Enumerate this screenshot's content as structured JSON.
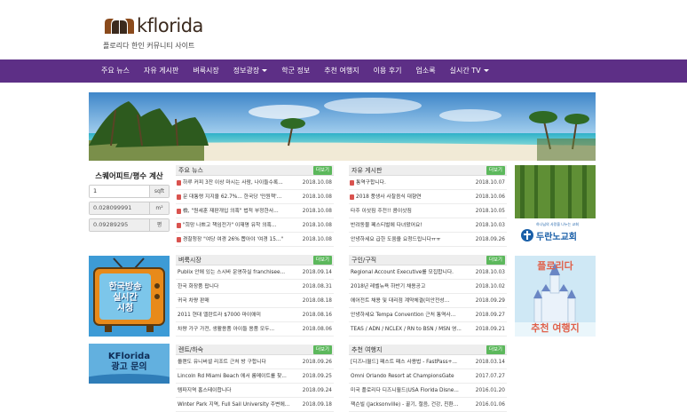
{
  "header": {
    "logo_text": "kflorida",
    "tagline": "플로리다 한인 커뮤니티 사이트"
  },
  "nav": {
    "items": [
      {
        "label": "주요 뉴스",
        "dropdown": false
      },
      {
        "label": "자유 게시판",
        "dropdown": false
      },
      {
        "label": "벼룩시장",
        "dropdown": false
      },
      {
        "label": "정보광장",
        "dropdown": true
      },
      {
        "label": "학군 정보",
        "dropdown": false
      },
      {
        "label": "추천 여행지",
        "dropdown": false
      },
      {
        "label": "이용 후기",
        "dropdown": false
      },
      {
        "label": "업소록",
        "dropdown": false
      },
      {
        "label": "실시간 TV",
        "dropdown": true
      }
    ]
  },
  "calculator": {
    "title": "스퀘어피트/평수 계산",
    "rows": [
      {
        "value": "1",
        "unit": "sqft",
        "readonly": false
      },
      {
        "value": "0.028099991",
        "unit": "m²",
        "readonly": true
      },
      {
        "value": "0.09289295",
        "unit": "평",
        "readonly": true
      }
    ]
  },
  "ads": {
    "tv": {
      "line1": "한국방송",
      "line2": "실시간",
      "line3": "시청"
    },
    "kflorida": {
      "line1": "KFlorida",
      "line2": "광고 문의"
    },
    "church": {
      "small": "하나님의 사랑을 나누는 교회",
      "name": "두란노교회"
    },
    "tour": {
      "line1": "플로리다",
      "line2": "추천 여행지"
    }
  },
  "boards": {
    "news": {
      "title": "주요 뉴스",
      "more": "더보기",
      "rows": [
        {
          "title": "하루 커피 3잔 이상 마시는 사람, 나이들수록...",
          "date": "2018.10.08",
          "new": true
        },
        {
          "title": "문 대통령 지지율 62.7%... 한국당 '민원책'...",
          "date": "2018.10.08",
          "new": true
        },
        {
          "title": "檢, \"원세훈 재판개입 의혹\" 법적 부정한사...",
          "date": "2018.10.08",
          "new": true
        },
        {
          "title": "\"희망 나쁘고 책임전가\" 이재명 유학 의혹...",
          "date": "2018.10.08",
          "new": true
        },
        {
          "title": "경찰청장 \"여당 여경 26% 뽑아야 '여경 15...\"",
          "date": "2018.10.08",
          "new": true
        }
      ]
    },
    "free": {
      "title": "자유 게시판",
      "more": "더보기",
      "rows": [
        {
          "title": "통역구합니다.",
          "date": "2018.10.07",
          "new": true
        },
        {
          "title": "2018 풍생사 사찰음식 대향연",
          "date": "2018.10.06",
          "new": true
        },
        {
          "title": "타주 이삿짐 주전!! 콤이삿짐",
          "date": "2018.10.05",
          "new": false
        },
        {
          "title": "반려동물 페스티벌에 다녀왔어요!",
          "date": "2018.10.03",
          "new": false
        },
        {
          "title": "안녕하세요 급한 도움을 요청드립니다ㅠㅠ",
          "date": "2018.09.26",
          "new": false
        }
      ]
    },
    "market": {
      "title": "벼룩시장",
      "more": "더보기",
      "rows": [
        {
          "title": "Publix 안에 있는 스시바 운영하실 franchisee...",
          "date": "2018.09.14"
        },
        {
          "title": "한국 화장품 팝니다",
          "date": "2018.08.31"
        },
        {
          "title": "귀국 차량 판매",
          "date": "2018.08.18"
        },
        {
          "title": "2011 현대 엘란트라 $7000 마이애미",
          "date": "2018.08.16"
        },
        {
          "title": "차량 가구 가전, 생활용품 아이들 용품 모두...",
          "date": "2018.08.06"
        }
      ]
    },
    "jobs": {
      "title": "구인/구직",
      "more": "더보기",
      "rows": [
        {
          "title": "Regional Account Executive를 모집합니다.",
          "date": "2018.10.03"
        },
        {
          "title": "2018년 레벨뉴욕 하반기 채용공고",
          "date": "2018.10.02"
        },
        {
          "title": "에어전트 채용 및 대리점 계약체결(미안전성...",
          "date": "2018.09.29"
        },
        {
          "title": "안녕하세요 Tempa Convention 근처 통역사...",
          "date": "2018.09.27"
        },
        {
          "title": "TEAS / ADN / NCLEX / RN to BSN / MSN 영...",
          "date": "2018.09.21"
        }
      ]
    },
    "rent": {
      "title": "렌트/하숙",
      "more": "더보기",
      "rows": [
        {
          "title": "올랜도 유니버셜 리조트 근처 방 구합니다",
          "date": "2018.09.26"
        },
        {
          "title": "Lincoln Rd Miami Beach 에서 룸메이트를 찾...",
          "date": "2018.09.25"
        },
        {
          "title": "템파지역 홈스테이합니다",
          "date": "2018.09.24"
        },
        {
          "title": "Winter Park 지역, Full Sail University 주변에...",
          "date": "2018.09.18"
        }
      ]
    },
    "travel": {
      "title": "추천 여행지",
      "more": "더보기",
      "rows": [
        {
          "title": "[디즈니월드] 패스트 패스 사용법 - FastPass+...",
          "date": "2018.03.14"
        },
        {
          "title": "Omni Orlando Resort at ChampionsGate",
          "date": "2017.07.27"
        },
        {
          "title": "미국 플로리다 디즈니월드(USA Florida Disne...",
          "date": "2016.01.20"
        },
        {
          "title": "잭슨빌 (Jacksonville) - 꿀기, 절음, 건강, 친환...",
          "date": "2016.01.06"
        }
      ]
    }
  }
}
